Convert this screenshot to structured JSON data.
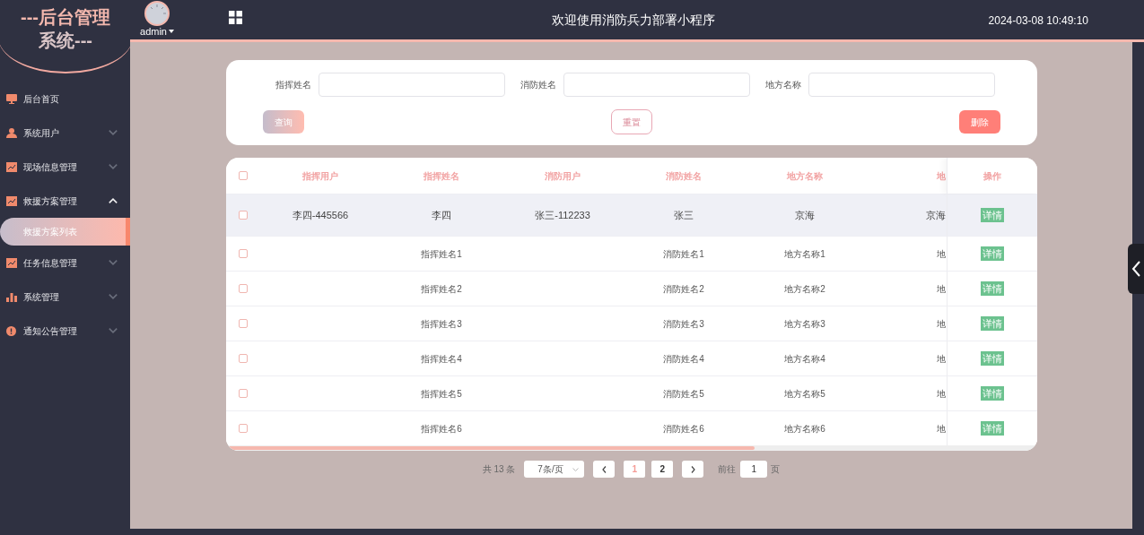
{
  "sidebar": {
    "title_line_1": "---后台管理",
    "title_line_2": "系统---",
    "items": [
      {
        "kind": "link",
        "label": "后台首页"
      },
      {
        "kind": "group",
        "label": "系统用户",
        "expanded": false
      },
      {
        "kind": "group",
        "label": "现场信息管理",
        "expanded": false
      },
      {
        "kind": "group",
        "label": "救援方案管理",
        "expanded": true,
        "children": [
          {
            "label": "救援方案列表",
            "selected": true
          }
        ]
      },
      {
        "kind": "group",
        "label": "任务信息管理",
        "expanded": false
      },
      {
        "kind": "group",
        "label": "系统管理",
        "expanded": false
      },
      {
        "kind": "group",
        "label": "通知公告管理",
        "expanded": false
      }
    ]
  },
  "header": {
    "user": "admin",
    "title": "欢迎使用消防兵力部署小程序",
    "datetime": "2024-03-08 10:49:10"
  },
  "search": {
    "fields": [
      {
        "label": "指挥姓名"
      },
      {
        "label": "消防姓名"
      },
      {
        "label": "地方名称"
      }
    ],
    "buttons": [
      {
        "kind": "query",
        "label": "查询"
      },
      {
        "kind": "reset",
        "label": "重置"
      },
      {
        "kind": "delete",
        "label": "删除"
      }
    ]
  },
  "table": {
    "all_checked": false,
    "columns": [
      "指挥用户",
      "指挥姓名",
      "消防用户",
      "消防姓名",
      "地方名称",
      "地"
    ],
    "action_column": "操作",
    "rows": [
      {
        "selected": true,
        "checked": false,
        "cells": [
          "李四-445566",
          "李四",
          "张三-112233",
          "张三",
          "京海",
          "京海"
        ],
        "action": "详情"
      },
      {
        "selected": false,
        "checked": false,
        "cells": [
          "",
          "指挥姓名1",
          "",
          "消防姓名1",
          "地方名称1",
          "地"
        ],
        "action": "详情"
      },
      {
        "selected": false,
        "checked": false,
        "cells": [
          "",
          "指挥姓名2",
          "",
          "消防姓名2",
          "地方名称2",
          "地"
        ],
        "action": "详情"
      },
      {
        "selected": false,
        "checked": false,
        "cells": [
          "",
          "指挥姓名3",
          "",
          "消防姓名3",
          "地方名称3",
          "地"
        ],
        "action": "详情"
      },
      {
        "selected": false,
        "checked": false,
        "cells": [
          "",
          "指挥姓名4",
          "",
          "消防姓名4",
          "地方名称4",
          "地"
        ],
        "action": "详情"
      },
      {
        "selected": false,
        "checked": false,
        "cells": [
          "",
          "指挥姓名5",
          "",
          "消防姓名5",
          "地方名称5",
          "地"
        ],
        "action": "详情"
      },
      {
        "selected": false,
        "checked": false,
        "cells": [
          "",
          "指挥姓名6",
          "",
          "消防姓名6",
          "地方名称6",
          "地"
        ],
        "action": "详情"
      }
    ]
  },
  "pagination": {
    "total": "共 13 条",
    "page_size": "7条/页",
    "pages": [
      {
        "label": "1",
        "selected": true
      },
      {
        "label": "2",
        "selected": false
      }
    ],
    "goto_label": "前往",
    "goto_value": "1",
    "goto_suffix": "页"
  }
}
